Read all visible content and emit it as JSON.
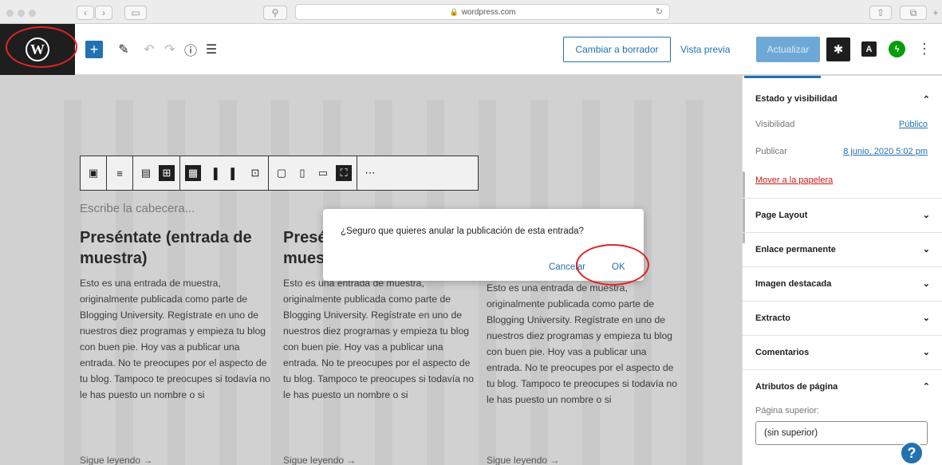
{
  "browser": {
    "url": "wordpress.com",
    "lock_icon": "🔒",
    "reload_icon": "↻",
    "back_icon": "‹",
    "forward_icon": "›",
    "sidebar_icon": "▭",
    "search_icon": "⚲",
    "share_icon": "⇧",
    "tabs_icon": "⧉",
    "newtab_icon": "+"
  },
  "toolbar": {
    "logo_letter": "W",
    "add_icon": "+",
    "tools_icon": "✎",
    "undo_icon": "↶",
    "redo_icon": "↷",
    "info_icon": "ⓘ",
    "outline_icon": "☰",
    "draft_label": "Cambiar a borrador",
    "preview_label": "Vista previa",
    "update_label": "Actualizar",
    "settings_icon": "✱",
    "a_icon": "A",
    "jetpack_icon": "ϟ",
    "more_icon": "⋮",
    "accent": "#2271b1"
  },
  "block_toolbar": {
    "groups": [
      [
        "▣"
      ],
      [
        "≡"
      ],
      [
        "▤",
        "⊞"
      ],
      [
        "▦",
        "▐",
        "▌",
        "⊡"
      ],
      [
        "▢",
        "▯",
        "▭",
        "⛶"
      ],
      [
        "⋯"
      ]
    ]
  },
  "editor": {
    "heading_placeholder": "Escribe la cabecera...",
    "columns": [
      {
        "title": "Preséntate (entrada de muestra)",
        "body": "Esto es una entrada de muestra, originalmente publicada como parte de Blogging University. Regístrate en uno de nuestros diez programas y empieza tu blog con buen pie. Hoy vas a publicar una entrada. No te preocupes por el aspecto de tu blog. Tampoco te preocupes si todavía no le has puesto un nombre o si",
        "more": "Sigue leyendo →"
      },
      {
        "title": "Preséntate (entrada de muestra)",
        "body": "Esto es una entrada de muestra, originalmente publicada como parte de Blogging University. Regístrate en uno de nuestros diez programas y empieza tu blog con buen pie. Hoy vas a publicar una entrada. No te preocupes por el aspecto de tu blog. Tampoco te preocupes si todavía no le has puesto un nombre o si",
        "more": "Sigue leyendo →"
      },
      {
        "title": "",
        "body": "Esto es una entrada de muestra, originalmente publicada como parte de Blogging University. Regístrate en uno de nuestros diez programas y empieza tu blog con buen pie. Hoy vas a publicar una entrada. No te preocupes por el aspecto de tu blog. Tampoco te preocupes si todavía no le has puesto un nombre o si",
        "more": "Sigue leyendo →"
      }
    ]
  },
  "modal": {
    "message": "¿Seguro que quieres anular la publicación de esta entrada?",
    "cancel_label": "Cancelar",
    "ok_label": "OK"
  },
  "sidebar": {
    "status_panel": {
      "title": "Estado y visibilidad",
      "visibility_label": "Visibilidad",
      "visibility_value": "Público",
      "publish_label": "Publicar",
      "publish_value": "8 junio, 2020 5:02 pm",
      "trash_label": "Mover a la papelera"
    },
    "panels": [
      "Page Layout",
      "Enlace permanente",
      "Imagen destacada",
      "Extracto",
      "Comentarios"
    ],
    "attributes_panel": {
      "title": "Atributos de página",
      "parent_label": "Página superior:",
      "parent_value": "(sin superior)"
    },
    "chevron_up": "⌃",
    "chevron_down": "⌄",
    "help_icon": "?"
  }
}
